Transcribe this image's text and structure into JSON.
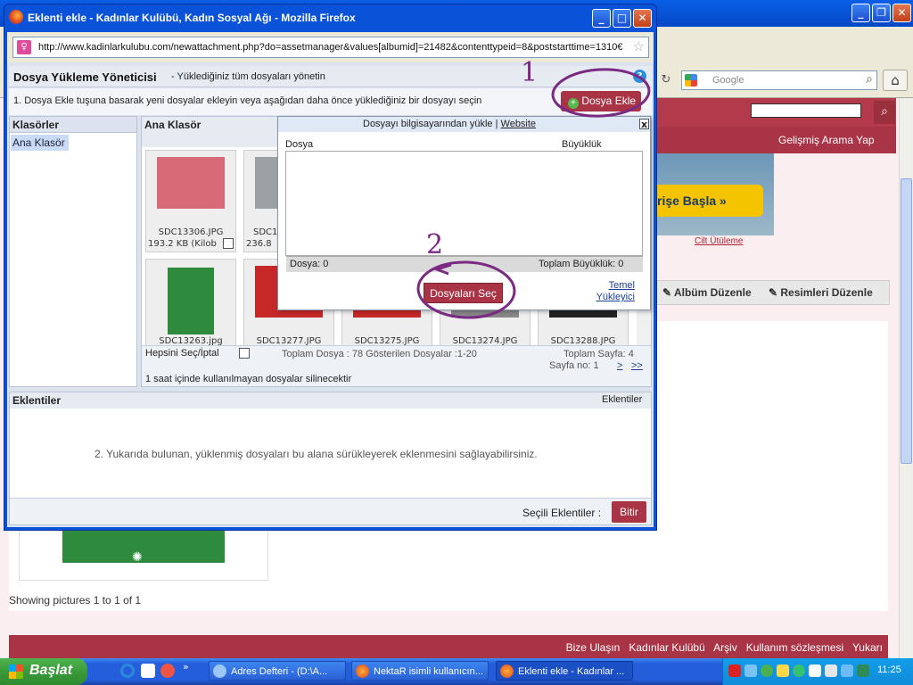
{
  "bg": {
    "search_placeholder": "Google",
    "nav_link": "Gelişmiş Arama Yap",
    "banner_button": "rişe Başla »",
    "banner_sub": "Cilt Ütüleme",
    "album_edit": "Albüm Düzenle",
    "images_edit": "Resimleri Düzenle",
    "showing": "Showing pictures 1 to 1 of 1",
    "footer_links": [
      "Bize Ulaşın",
      "Kadınlar Kulübü",
      "Arşiv",
      "Kullanım sözleşmesi",
      "Yukarı"
    ]
  },
  "popup": {
    "title": "Eklenti ekle - Kadınlar Kulübü, Kadın Sosyal Ağı - Mozilla Firefox",
    "url": "http://www.kadinlarkulubu.com/newattachment.php?do=assetmanager&values[albumid]=21482&contenttypeid=8&poststarttime=1310€",
    "manager_title": "Dosya Yükleme Yöneticisi",
    "manager_sub": "- Yüklediğiniz tüm dosyaları yönetin",
    "help": "?",
    "instruction": "1. Dosya Ekle tuşuna basarak yeni dosyalar ekleyin veya aşağıdan daha önce yüklediğiniz bir dosyayı seçin",
    "add_button": "Dosya Ekle",
    "folders_header": "Klasörler",
    "folder_item": "Ana Klasör",
    "main_folder_header": "Ana Klasör",
    "select_all": "Hepsini Seç/İptal",
    "total_files": "Toplam Dosya : 78 Gösterilen Dosyalar :1-20",
    "total_pages": "Toplam Sayfa: 4",
    "page_no": "Sayfa no: 1",
    "next": ">",
    "last": ">>",
    "delete_note": "1 saat içinde kullanılmayan dosyalar silinecektir",
    "attachments_header": "Eklentiler",
    "attachments_right": "Eklentiler",
    "drag_note": "2. Yukarıda bulunan, yüklenmiş dosyaları bu alana sürükleyerek eklenmesini sağlayabilirsiniz.",
    "selected_label": "Seçili Eklentiler :",
    "finish_button": "Bitir",
    "thumbs": [
      {
        "name": "SDC13306.JPG",
        "size": "193.2 KB (Kilob",
        "color": "#d86a78"
      },
      {
        "name": "SDC1",
        "size": "236.8",
        "color": "#9aa0a4"
      },
      {
        "name": "SDC13263.jpg",
        "size": "",
        "color": "#2e8b3e"
      },
      {
        "name": "SDC13277.JPG",
        "size": "",
        "color": "#c62828"
      },
      {
        "name": "SDC13275.JPG",
        "size": "",
        "color": "#c62828"
      },
      {
        "name": "SDC13274.JPG",
        "size": "",
        "color": "#888888"
      },
      {
        "name": "SDC13288.JPG",
        "size": "",
        "color": "#222222"
      }
    ]
  },
  "upload": {
    "title": "Dosyayı bilgisayarından yükle",
    "sep": "|",
    "website": "Website",
    "close": "x",
    "col_file": "Dosya",
    "col_size": "Büyüklük",
    "count": "Dosya: 0",
    "total_size": "Toplam Büyüklük: 0",
    "select_button": "Dosyaları Seç",
    "basic_1": "Temel",
    "basic_2": "Yükleyici"
  },
  "annotations": {
    "one": "1",
    "two": "2"
  },
  "taskbar": {
    "start": "Başlat",
    "items": [
      "Adres Defteri - (D:\\A...",
      "NektaR isimli kullanıcın...",
      "Eklenti ekle - Kadınlar ..."
    ],
    "clock": "11:25"
  }
}
